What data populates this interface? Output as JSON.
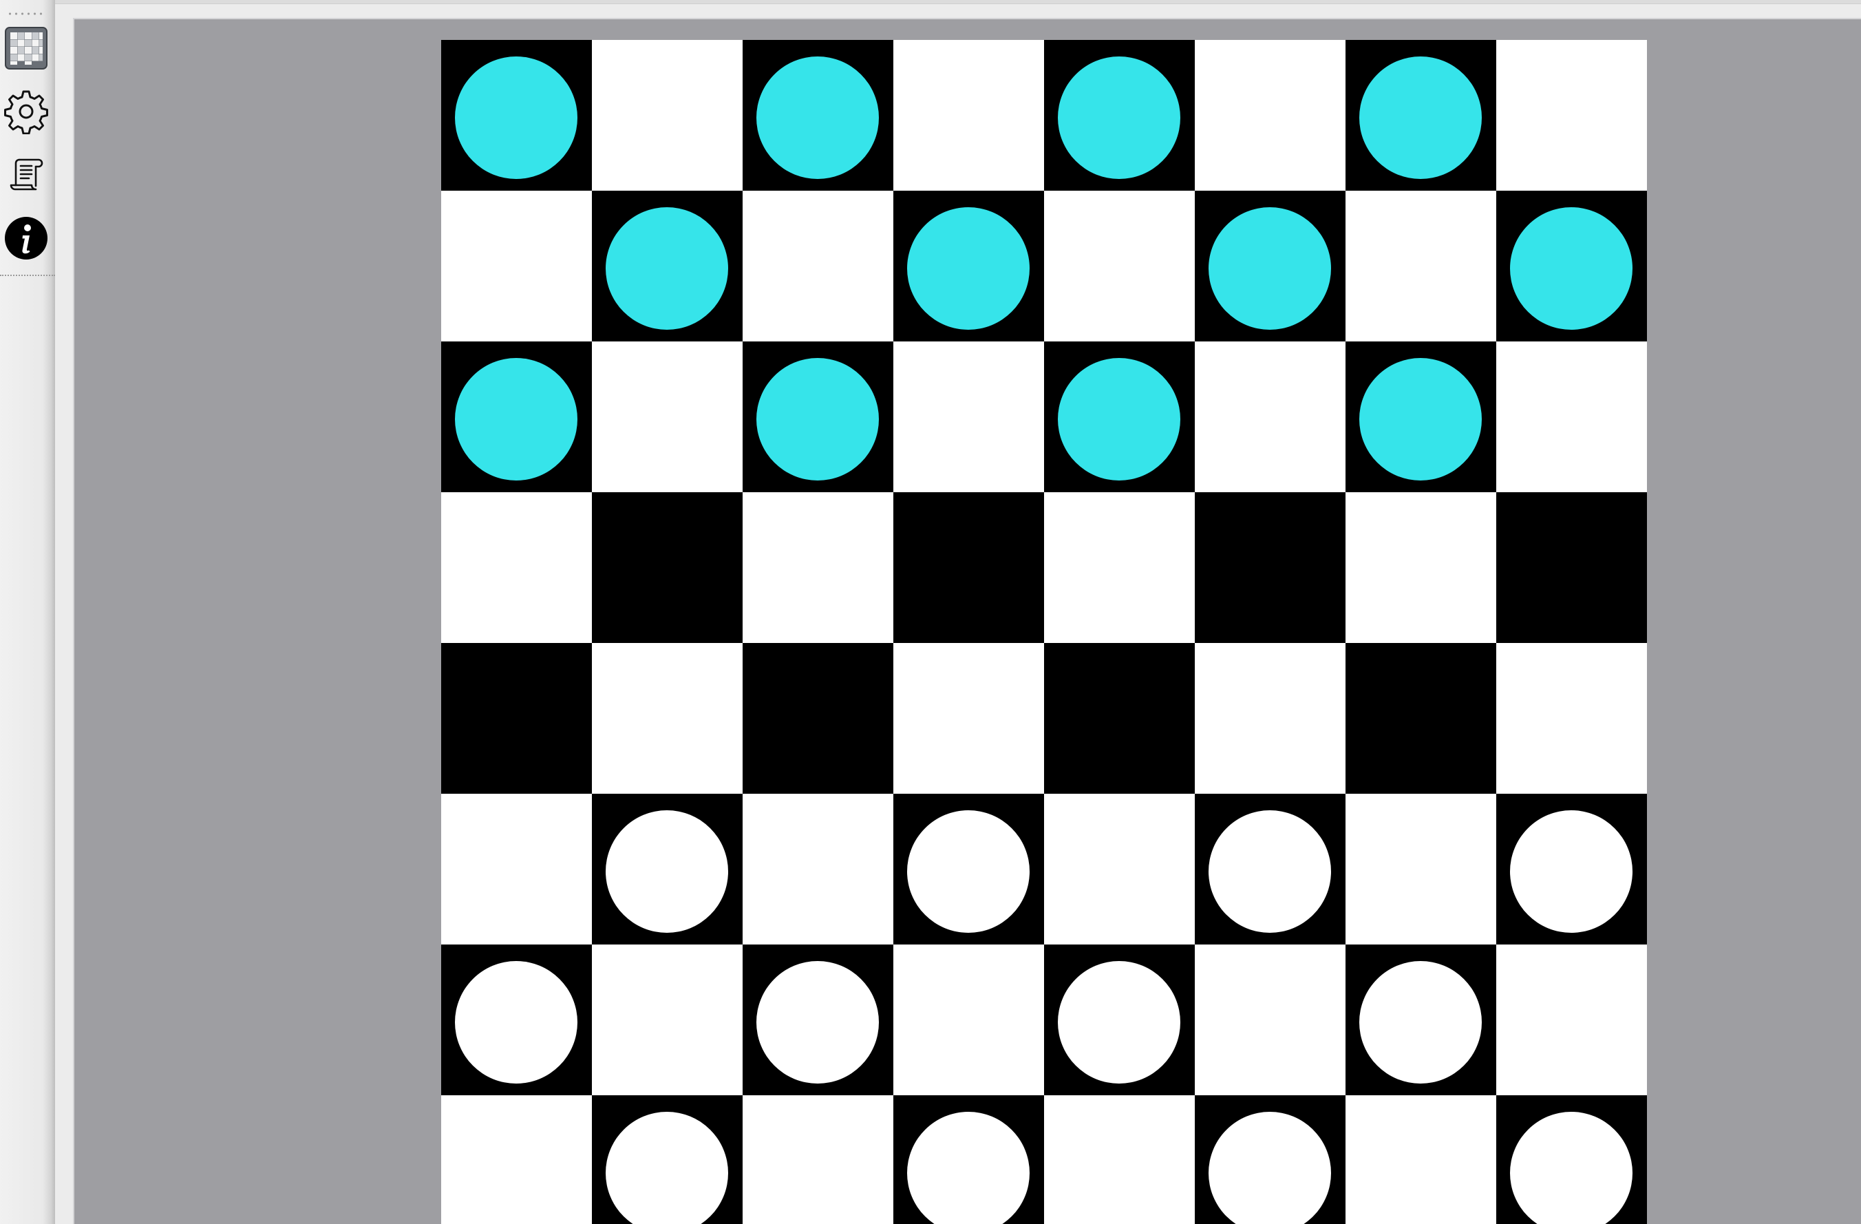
{
  "toolbar": {
    "buttons": [
      {
        "name": "board-icon",
        "label": "board"
      },
      {
        "name": "settings-icon",
        "label": "settings"
      },
      {
        "name": "log-icon",
        "label": "log"
      },
      {
        "name": "info-icon",
        "label": "info"
      }
    ]
  },
  "board": {
    "size": 8,
    "colors": {
      "light_square": "#ffffff",
      "dark_square": "#000000",
      "top_player_piece": "#36e4ea",
      "bottom_player_piece": "#ffffff",
      "background": "#9e9ea2"
    },
    "rows": [
      [
        "c",
        ".",
        "c",
        ".",
        "c",
        ".",
        "c",
        "."
      ],
      [
        ".",
        "c",
        ".",
        "c",
        ".",
        "c",
        ".",
        "c"
      ],
      [
        "c",
        ".",
        "c",
        ".",
        "c",
        ".",
        "c",
        "."
      ],
      [
        ".",
        ".",
        ".",
        ".",
        ".",
        ".",
        ".",
        "."
      ],
      [
        ".",
        ".",
        ".",
        ".",
        ".",
        ".",
        ".",
        "."
      ],
      [
        ".",
        "w",
        ".",
        "w",
        ".",
        "w",
        ".",
        "w"
      ],
      [
        "w",
        ".",
        "w",
        ".",
        "w",
        ".",
        "w",
        "."
      ],
      [
        ".",
        "w",
        ".",
        "w",
        ".",
        "w",
        ".",
        "w"
      ]
    ],
    "legend": {
      "c": "cyan-checker",
      "w": "white-checker",
      ".": "empty"
    }
  }
}
